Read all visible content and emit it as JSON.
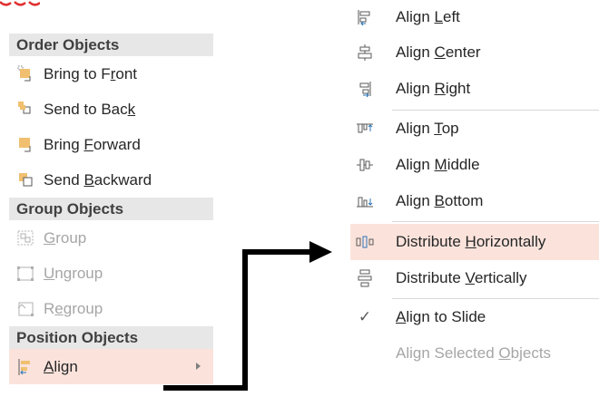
{
  "left_menu": {
    "order_header": "Order Objects",
    "bring_to_front": {
      "pre": "Bring to F",
      "key": "r",
      "post": "ont"
    },
    "send_to_back": {
      "pre": "Send to Bac",
      "key": "k",
      "post": ""
    },
    "bring_forward": {
      "pre": "Bring ",
      "key": "F",
      "post": "orward"
    },
    "send_backward": {
      "pre": "Send ",
      "key": "B",
      "post": "ackward"
    },
    "group_header": "Group Objects",
    "group": {
      "pre": "",
      "key": "G",
      "post": "roup"
    },
    "ungroup": {
      "pre": "",
      "key": "U",
      "post": "ngroup"
    },
    "regroup": {
      "pre": "R",
      "key": "e",
      "post": "group"
    },
    "position_header": "Position Objects",
    "align": {
      "pre": "",
      "key": "A",
      "post": "lign"
    }
  },
  "right_menu": {
    "align_left": {
      "pre": "Align ",
      "key": "L",
      "post": "eft"
    },
    "align_center": {
      "pre": "Align ",
      "key": "C",
      "post": "enter"
    },
    "align_right": {
      "pre": "Align ",
      "key": "R",
      "post": "ight"
    },
    "align_top": {
      "pre": "Align ",
      "key": "T",
      "post": "op"
    },
    "align_middle": {
      "pre": "Align ",
      "key": "M",
      "post": "iddle"
    },
    "align_bottom": {
      "pre": "Align ",
      "key": "B",
      "post": "ottom"
    },
    "distribute_horizontally": {
      "pre": "Distribute ",
      "key": "H",
      "post": "orizontally"
    },
    "distribute_vertically": {
      "pre": "Distribute ",
      "key": "V",
      "post": "ertically"
    },
    "align_to_slide": {
      "pre": "",
      "key": "A",
      "post": "lign to Slide"
    },
    "align_selected_objects": {
      "pre": "Align Selected ",
      "key": "O",
      "post": "bjects"
    },
    "checkmark": "✓"
  },
  "colors": {
    "highlight": "#fbe3dc",
    "header_bg": "#e7e7e7",
    "icon_blue": "#2e75b6",
    "icon_orange": "#f0c070",
    "disabled_text": "#a6a6a6",
    "corner_mark": "#e03030"
  }
}
